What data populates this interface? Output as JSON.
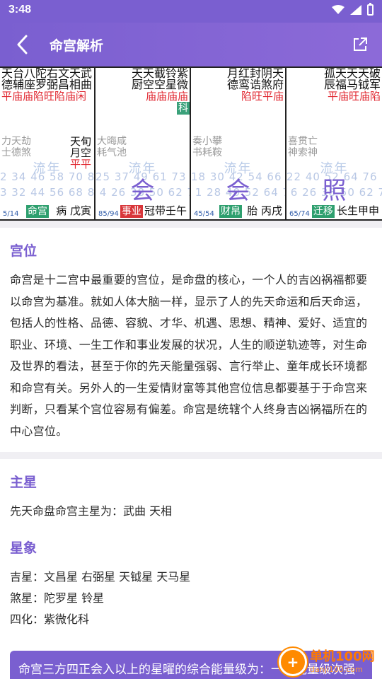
{
  "status_bar": {
    "time": "3:48"
  },
  "app_bar": {
    "title": "命宫解析"
  },
  "chart": {
    "palaces": [
      {
        "top_row1": "天台八陀右文天武",
        "top_row2": "德辅座罗弼昌相曲",
        "red_row": "平庙庙陷旺陷庙闲",
        "gray": "力天劫\n士德煞",
        "right_row1": "天旬",
        "right_row2": "月空",
        "right_red": "平平",
        "flow": "流年",
        "nums": "2 34 46 58 70 82 9\n3 32 44 56 68 80 9",
        "big": "",
        "ratio": "5/14",
        "tag": "命宫",
        "tag_color": "green",
        "tail": "病 戊寅"
      },
      {
        "top_row1": "天天截铃紫",
        "top_row2": "厨空空星微",
        "red_row": "    庙庙庙庙",
        "gray": "大晦咸\n耗气池",
        "right_row1": "",
        "right_row2": "",
        "right_red": "",
        "flow": "流年",
        "nums": "25 37 49 61 73 85\n 4 26 38 50 62 74",
        "big": "会",
        "ratio": "85/94",
        "tag": "事业",
        "tag_color": "red",
        "tail": "冠带壬午",
        "badge": "科"
      },
      {
        "top_row1": "月红封阴天",
        "top_row2": "德鸾诰煞府",
        "red_row": "   陷旺平庙",
        "gray": "奏小攀\n书耗鞍",
        "right_row1": "",
        "right_row2": "",
        "right_red": "",
        "flow": "流年",
        "nums": "18 30 42 54 66 78\n 1 28 40 52 64 76",
        "big": "会",
        "ratio": "45/54",
        "tag": "财帛",
        "tag_color": "green",
        "tail": "胎 丙戌"
      },
      {
        "top_row1": "孤天天天破",
        "top_row2": "辰福马钺军",
        "red_row": "平庙旺庙陷",
        "gray": "喜贯亡\n神索神",
        "right_row1": "",
        "right_row2": "",
        "right_red": "",
        "flow": "流年",
        "nums": "22 40 52 64 76\n 6 26 38 50 62 74",
        "big": "照",
        "ratio": "65/74",
        "tag": "迁移",
        "tag_color": "green",
        "tail": "长生甲申"
      }
    ]
  },
  "sections": {
    "position": {
      "title": "宫位",
      "body": "命宫是十二宫中最重要的宫位，是命盘的核心，一个人的吉凶祸福都要以命宫为基准。就如人体大脑一样，显示了人的先天命运和后天命运，包括人的性格、品德、容貌、才华、机遇、思想、精神、爱好、适宜的职业、环境、一生工作和事业发展的状况，人生的顺逆轨迹等，对生命及世界的看法，甚至于你的先天能量强弱、言行举止、童年成长环境都和命宫有关。另外人的一生爱情财富等其他宫位信息都要基于于命宫来判断，只看某个宫位容易有偏差。命宫是统辖个人终身吉凶祸福所在的中心宫位。"
    },
    "main_star": {
      "title": "主星",
      "body": "先天命盘命宫主星为：武曲 天相"
    },
    "star_signs": {
      "title": "星象",
      "lucky": "吉星：文昌星 右弼星 天钺星 天马星",
      "evil": "煞星：陀罗星 铃星",
      "transform": "四化：紫微化科"
    }
  },
  "banner": {
    "text": "命宫三方四正会入以上的星曜的综合能量级为：一般能量级次强"
  },
  "watermark": {
    "name": "单机100网",
    "url": "danji100.com"
  }
}
